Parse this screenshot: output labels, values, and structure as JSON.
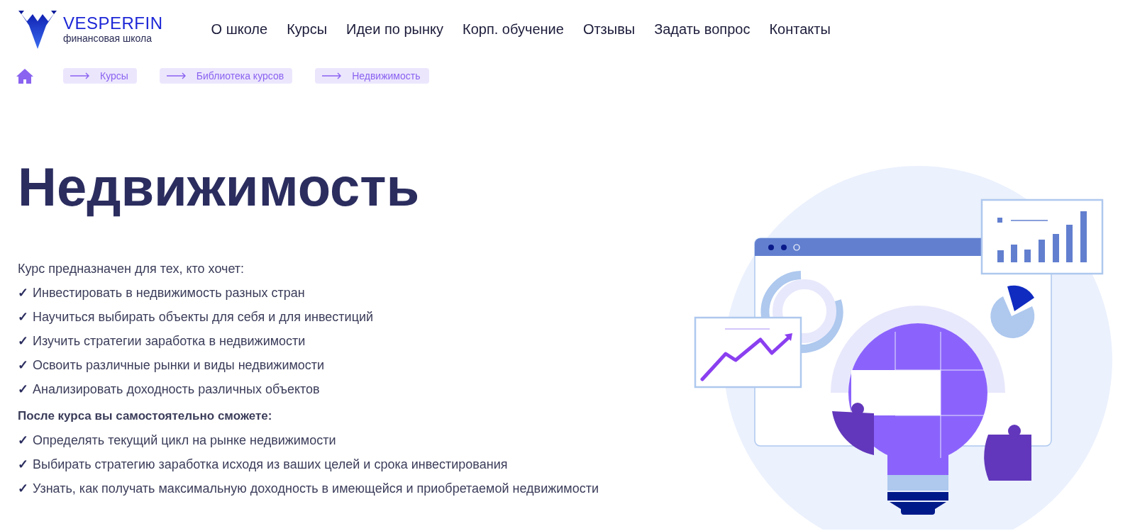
{
  "logo": {
    "name": "VESPERFIN",
    "tagline": "финансовая школа"
  },
  "nav": [
    "О школе",
    "Курсы",
    "Идеи по рынку",
    "Корп. обучение",
    "Отзывы",
    "Задать вопрос",
    "Контакты"
  ],
  "breadcrumbs": [
    "Курсы",
    "Библиотека курсов",
    "Недвижимость"
  ],
  "title": "Недвижимость",
  "intro": "Курс предназначен для тех, кто хочет:",
  "goals": [
    {
      "mark": "✓",
      "text": "Инвестировать в недвижимость разных стран"
    },
    {
      "mark": "✓",
      "text": "Научиться выбирать объекты для себя и для инвестиций"
    },
    {
      "mark": "✓",
      "text": "Изучить стратегии заработка в недвижимости"
    },
    {
      "mark": "✓",
      "text": "Освоить различные рынки и виды недвижимости"
    },
    {
      "mark": "✓",
      "text": "Анализировать доходность различных объектов"
    }
  ],
  "outcomes_heading": "После курса вы самостоятельно сможете:",
  "outcomes": [
    {
      "mark": "✓",
      "text": "Определять текущий цикл на рынке недвижимости"
    },
    {
      "mark": "✓",
      "text": "Выбирать стратегию заработка исходя из ваших целей и срока инвестирования"
    },
    {
      "mark": "✓",
      "text": "Узнать, как получать максимальную доходность в имеющейся и приобретаемой недвижимости"
    }
  ]
}
